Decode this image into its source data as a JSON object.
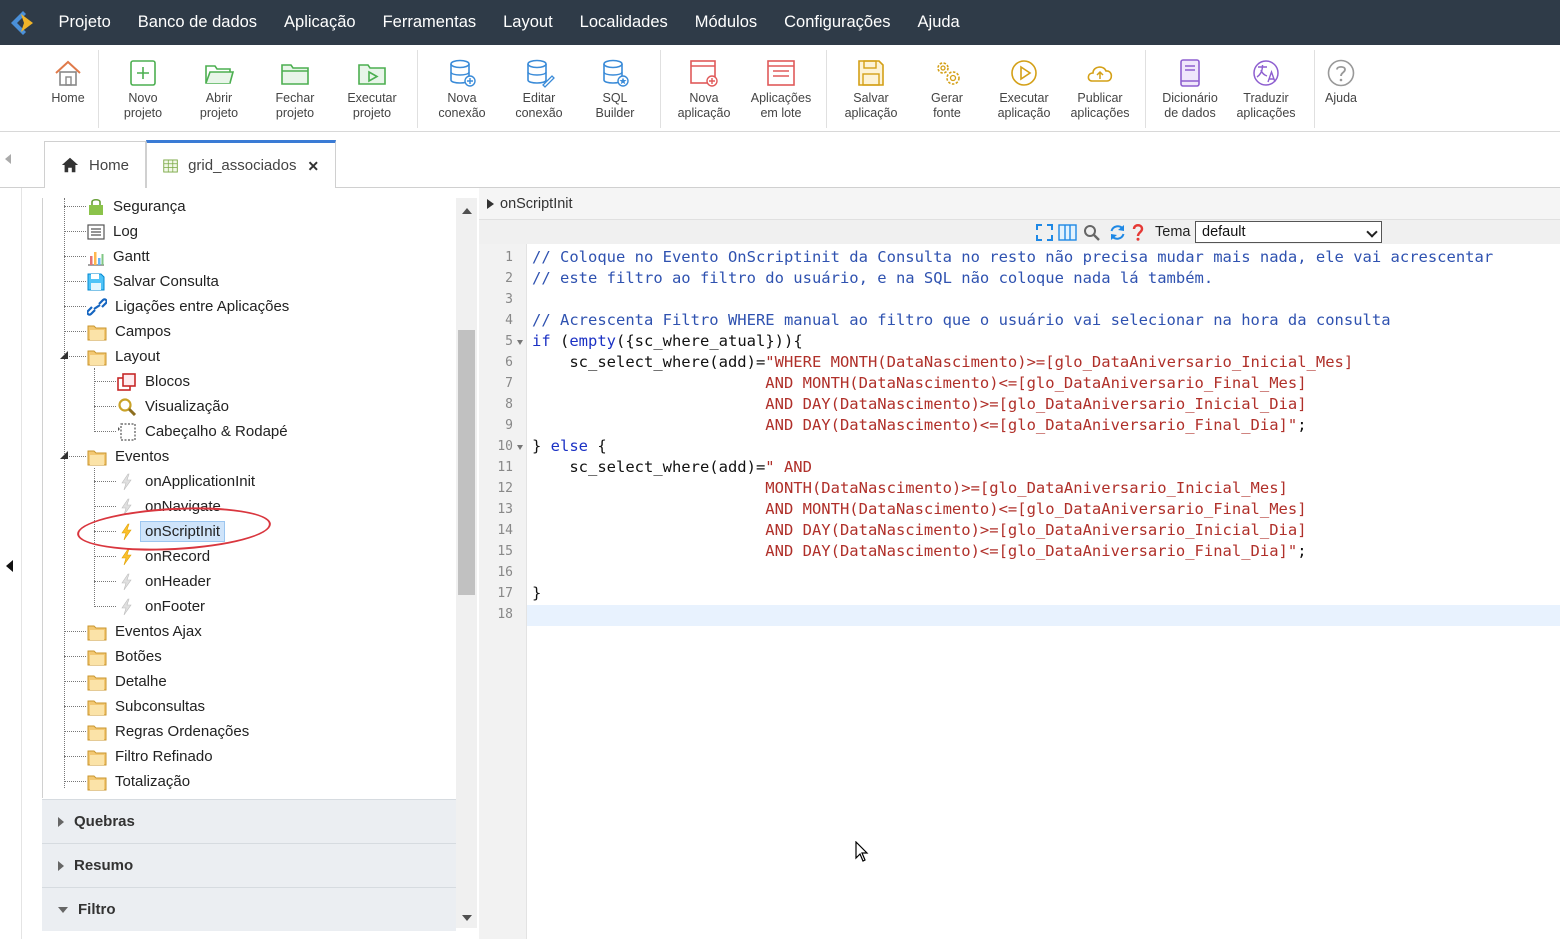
{
  "menu": {
    "items": [
      "Projeto",
      "Banco de dados",
      "Aplicação",
      "Ferramentas",
      "Layout",
      "Localidades",
      "Módulos",
      "Configurações",
      "Ajuda"
    ]
  },
  "toolbar": {
    "home": "Home",
    "novo_projeto": "Novo\nprojeto",
    "abrir_projeto": "Abrir\nprojeto",
    "fechar_projeto": "Fechar\nprojeto",
    "executar_projeto": "Executar\nprojeto",
    "nova_conexao": "Nova\nconexão",
    "editar_conexao": "Editar\nconexão",
    "sql_builder": "SQL\nBuilder",
    "nova_aplicacao": "Nova\naplicação",
    "aplicacoes_em_lote": "Aplicações\nem lote",
    "salvar_aplicacao": "Salvar\naplicação",
    "gerar_fonte": "Gerar\nfonte",
    "executar_aplicacao": "Executar\naplicação",
    "publicar_aplicacoes": "Publicar\naplicações",
    "dicionario_de_dados": "Dicionário\nde dados",
    "traduzir_aplicacoes": "Traduzir\naplicações",
    "ajuda": "Ajuda"
  },
  "tabs": [
    {
      "label": "Home"
    },
    {
      "label": "grid_associados"
    }
  ],
  "tree": {
    "items": [
      "Segurança",
      "Log",
      "Gantt",
      "Salvar Consulta",
      "Ligações entre Aplicações",
      "Campos",
      "Layout",
      "Blocos",
      "Visualização",
      "Cabeçalho & Rodapé",
      "Eventos",
      "onApplicationInit",
      "onNavigate",
      "onScriptInit",
      "onRecord",
      "onHeader",
      "onFooter",
      "Eventos Ajax",
      "Botões",
      "Detalhe",
      "Subconsultas",
      "Regras Ordenações",
      "Filtro Refinado",
      "Totalização"
    ],
    "selected": "onScriptInit"
  },
  "accordion": {
    "quebras": "Quebras",
    "resumo": "Resumo",
    "filtro": "Filtro"
  },
  "editor": {
    "title": "onScriptInit",
    "theme_label": "Tema",
    "theme_value": "default",
    "line_numbers": [
      "1",
      "2",
      "3",
      "4",
      "5",
      "6",
      "7",
      "8",
      "9",
      "10",
      "11",
      "12",
      "13",
      "14",
      "15",
      "16",
      "17",
      "18"
    ],
    "code": [
      "// Coloque no Evento OnScriptinit da Consulta no resto não precisa mudar mais nada, ele vai acrescentar",
      "// este filtro ao filtro do usuário, e na SQL não coloque nada lá também.",
      "",
      "// Acrescenta Filtro WHERE manual ao filtro que o usuário vai selecionar na hora da consulta",
      "if (empty({sc_where_atual})){",
      "    sc_select_where(add)=\"WHERE MONTH(DataNascimento)>=[glo_DataAniversario_Inicial_Mes]",
      "                         AND MONTH(DataNascimento)<=[glo_DataAniversario_Final_Mes]",
      "                         AND DAY(DataNascimento)>=[glo_DataAniversario_Inicial_Dia]",
      "                         AND DAY(DataNascimento)<=[glo_DataAniversario_Final_Dia]\";",
      "} else {",
      "    sc_select_where(add)=\" AND",
      "                         MONTH(DataNascimento)>=[glo_DataAniversario_Inicial_Mes]",
      "                         AND MONTH(DataNascimento)<=[glo_DataAniversario_Final_Mes]",
      "                         AND DAY(DataNascimento)>=[glo_DataAniversario_Inicial_Dia]",
      "                         AND DAY(DataNascimento)<=[glo_DataAniversario_Final_Dia]\";",
      "",
      "}",
      ""
    ]
  },
  "colors": {
    "menubar": "#2f3b48",
    "accent": "#3a7bd5",
    "annotation": "#d9363e",
    "comment": "#2f52b0",
    "keyword": "#1b31c4",
    "string": "#b0302a"
  }
}
